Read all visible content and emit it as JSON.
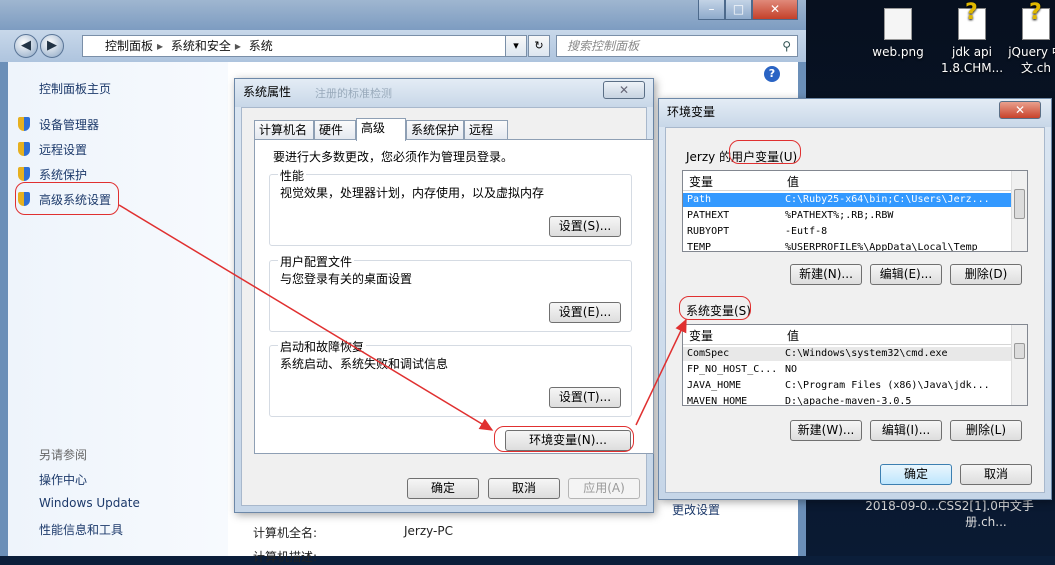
{
  "desktop": {
    "icons": [
      {
        "label": "web.png",
        "type": "doc"
      },
      {
        "label": "jdk api 1.8.CHM...",
        "type": "chm"
      },
      {
        "label": "jQuery 中文.ch",
        "type": "chm"
      }
    ],
    "bottom_captions": [
      "2018-09-0...",
      "CSS2[1].0中文手册.ch..."
    ]
  },
  "control_panel": {
    "breadcrumbs": [
      "控制面板",
      "系统和安全",
      "系统"
    ],
    "search_placeholder": "搜索控制面板",
    "sidebar": {
      "home": "控制面板主页",
      "items": [
        "设备管理器",
        "远程设置",
        "系统保护",
        "高级系统设置"
      ],
      "see_also_heading": "另请参阅",
      "see_also": [
        "操作中心",
        "Windows Update",
        "性能信息和工具"
      ]
    },
    "bottom_rows": [
      {
        "label": "计算机全名:",
        "value": "Jerzy-PC"
      },
      {
        "label": "计算机描述:",
        "value": ""
      }
    ],
    "change_settings_link": "更改设置",
    "background_text": "注册的标准检测"
  },
  "system_properties": {
    "title": "系统属性",
    "close_glyph": "✕",
    "tabs": [
      "计算机名",
      "硬件",
      "高级",
      "系统保护",
      "远程"
    ],
    "active_tab": "高级",
    "admin_note": "要进行大多数更改，您必须作为管理员登录。",
    "groups": [
      {
        "label": "性能",
        "desc": "视觉效果，处理器计划，内存使用，以及虚拟内存",
        "button": "设置(S)..."
      },
      {
        "label": "用户配置文件",
        "desc": "与您登录有关的桌面设置",
        "button": "设置(E)..."
      },
      {
        "label": "启动和故障恢复",
        "desc": "系统启动、系统失败和调试信息",
        "button": "设置(T)..."
      }
    ],
    "env_button": "环境变量(N)...",
    "ok": "确定",
    "cancel": "取消",
    "apply": "应用(A)"
  },
  "env_vars": {
    "title": "环境变量",
    "close_glyph": "✕",
    "user_section": "Jerzy 的用户变量(U)",
    "system_section": "系统变量(S)",
    "col_var": "变量",
    "col_val": "值",
    "user_rows": [
      {
        "k": "Path",
        "v": "C:\\Ruby25-x64\\bin;C:\\Users\\Jerz...",
        "state": "sel"
      },
      {
        "k": "PATHEXT",
        "v": "%PATHEXT%;.RB;.RBW",
        "state": ""
      },
      {
        "k": "RUBYOPT",
        "v": "-Eutf-8",
        "state": ""
      },
      {
        "k": "TEMP",
        "v": "%USERPROFILE%\\AppData\\Local\\Temp",
        "state": ""
      }
    ],
    "system_rows": [
      {
        "k": "ComSpec",
        "v": "C:\\Windows\\system32\\cmd.exe",
        "state": "hl"
      },
      {
        "k": "FP_NO_HOST_C...",
        "v": "NO",
        "state": ""
      },
      {
        "k": "JAVA_HOME",
        "v": "C:\\Program Files (x86)\\Java\\jdk...",
        "state": ""
      },
      {
        "k": "MAVEN_HOME",
        "v": "D:\\apache-maven-3.0.5",
        "state": ""
      }
    ],
    "user_buttons": [
      "新建(N)...",
      "编辑(E)...",
      "删除(D)"
    ],
    "system_buttons": [
      "新建(W)...",
      "编辑(I)...",
      "删除(L)"
    ],
    "ok": "确定",
    "cancel": "取消"
  },
  "colors": {
    "annotation": "#e03030",
    "selection": "#3399ff",
    "link": "#1d3a6b"
  }
}
